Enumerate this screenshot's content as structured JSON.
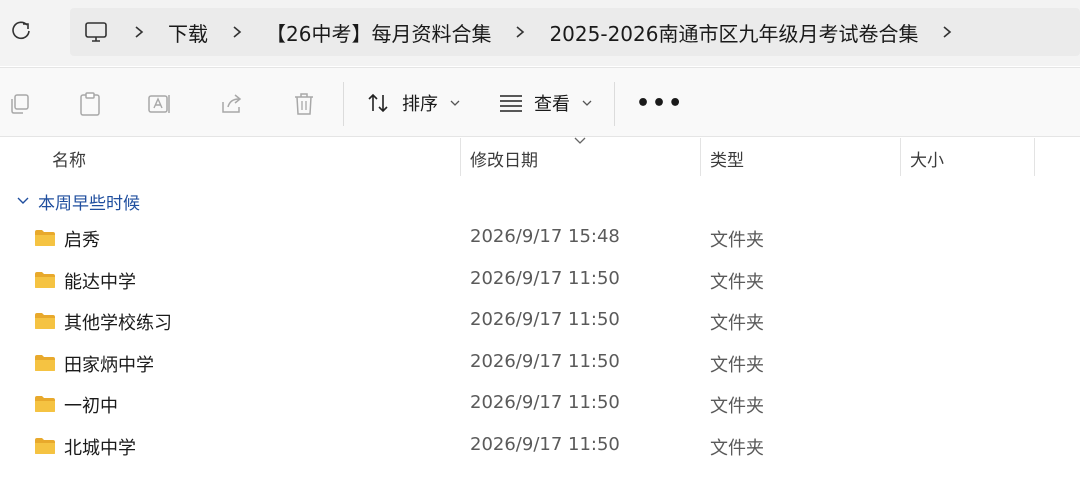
{
  "toolbar_address": {
    "breadcrumbs": [
      "下载",
      "【26中考】每月资料合集",
      "2025-2026南通市区九年级月考试卷合集"
    ]
  },
  "command_bar": {
    "sort_label": "排序",
    "view_label": "查看",
    "more_label": "•••",
    "icons": [
      "copy-icon",
      "paste-icon",
      "rename-icon",
      "share-icon",
      "delete-icon"
    ]
  },
  "columns": {
    "name": "名称",
    "modified": "修改日期",
    "type": "类型",
    "size": "大小"
  },
  "group": {
    "label": "本周早些时候"
  },
  "files": [
    {
      "name": "启秀",
      "modified": "2026/9/17 15:48",
      "type": "文件夹"
    },
    {
      "name": "能达中学",
      "modified": "2026/9/17 11:50",
      "type": "文件夹"
    },
    {
      "name": "其他学校练习",
      "modified": "2026/9/17 11:50",
      "type": "文件夹"
    },
    {
      "name": "田家炳中学",
      "modified": "2026/9/17 11:50",
      "type": "文件夹"
    },
    {
      "name": "一初中",
      "modified": "2026/9/17 11:50",
      "type": "文件夹"
    },
    {
      "name": "北城中学",
      "modified": "2026/9/17 11:50",
      "type": "文件夹"
    }
  ],
  "colors": {
    "folder": "#f5c342",
    "group_text": "#1f4e9e",
    "disabled_icon": "#a8a8a8"
  }
}
